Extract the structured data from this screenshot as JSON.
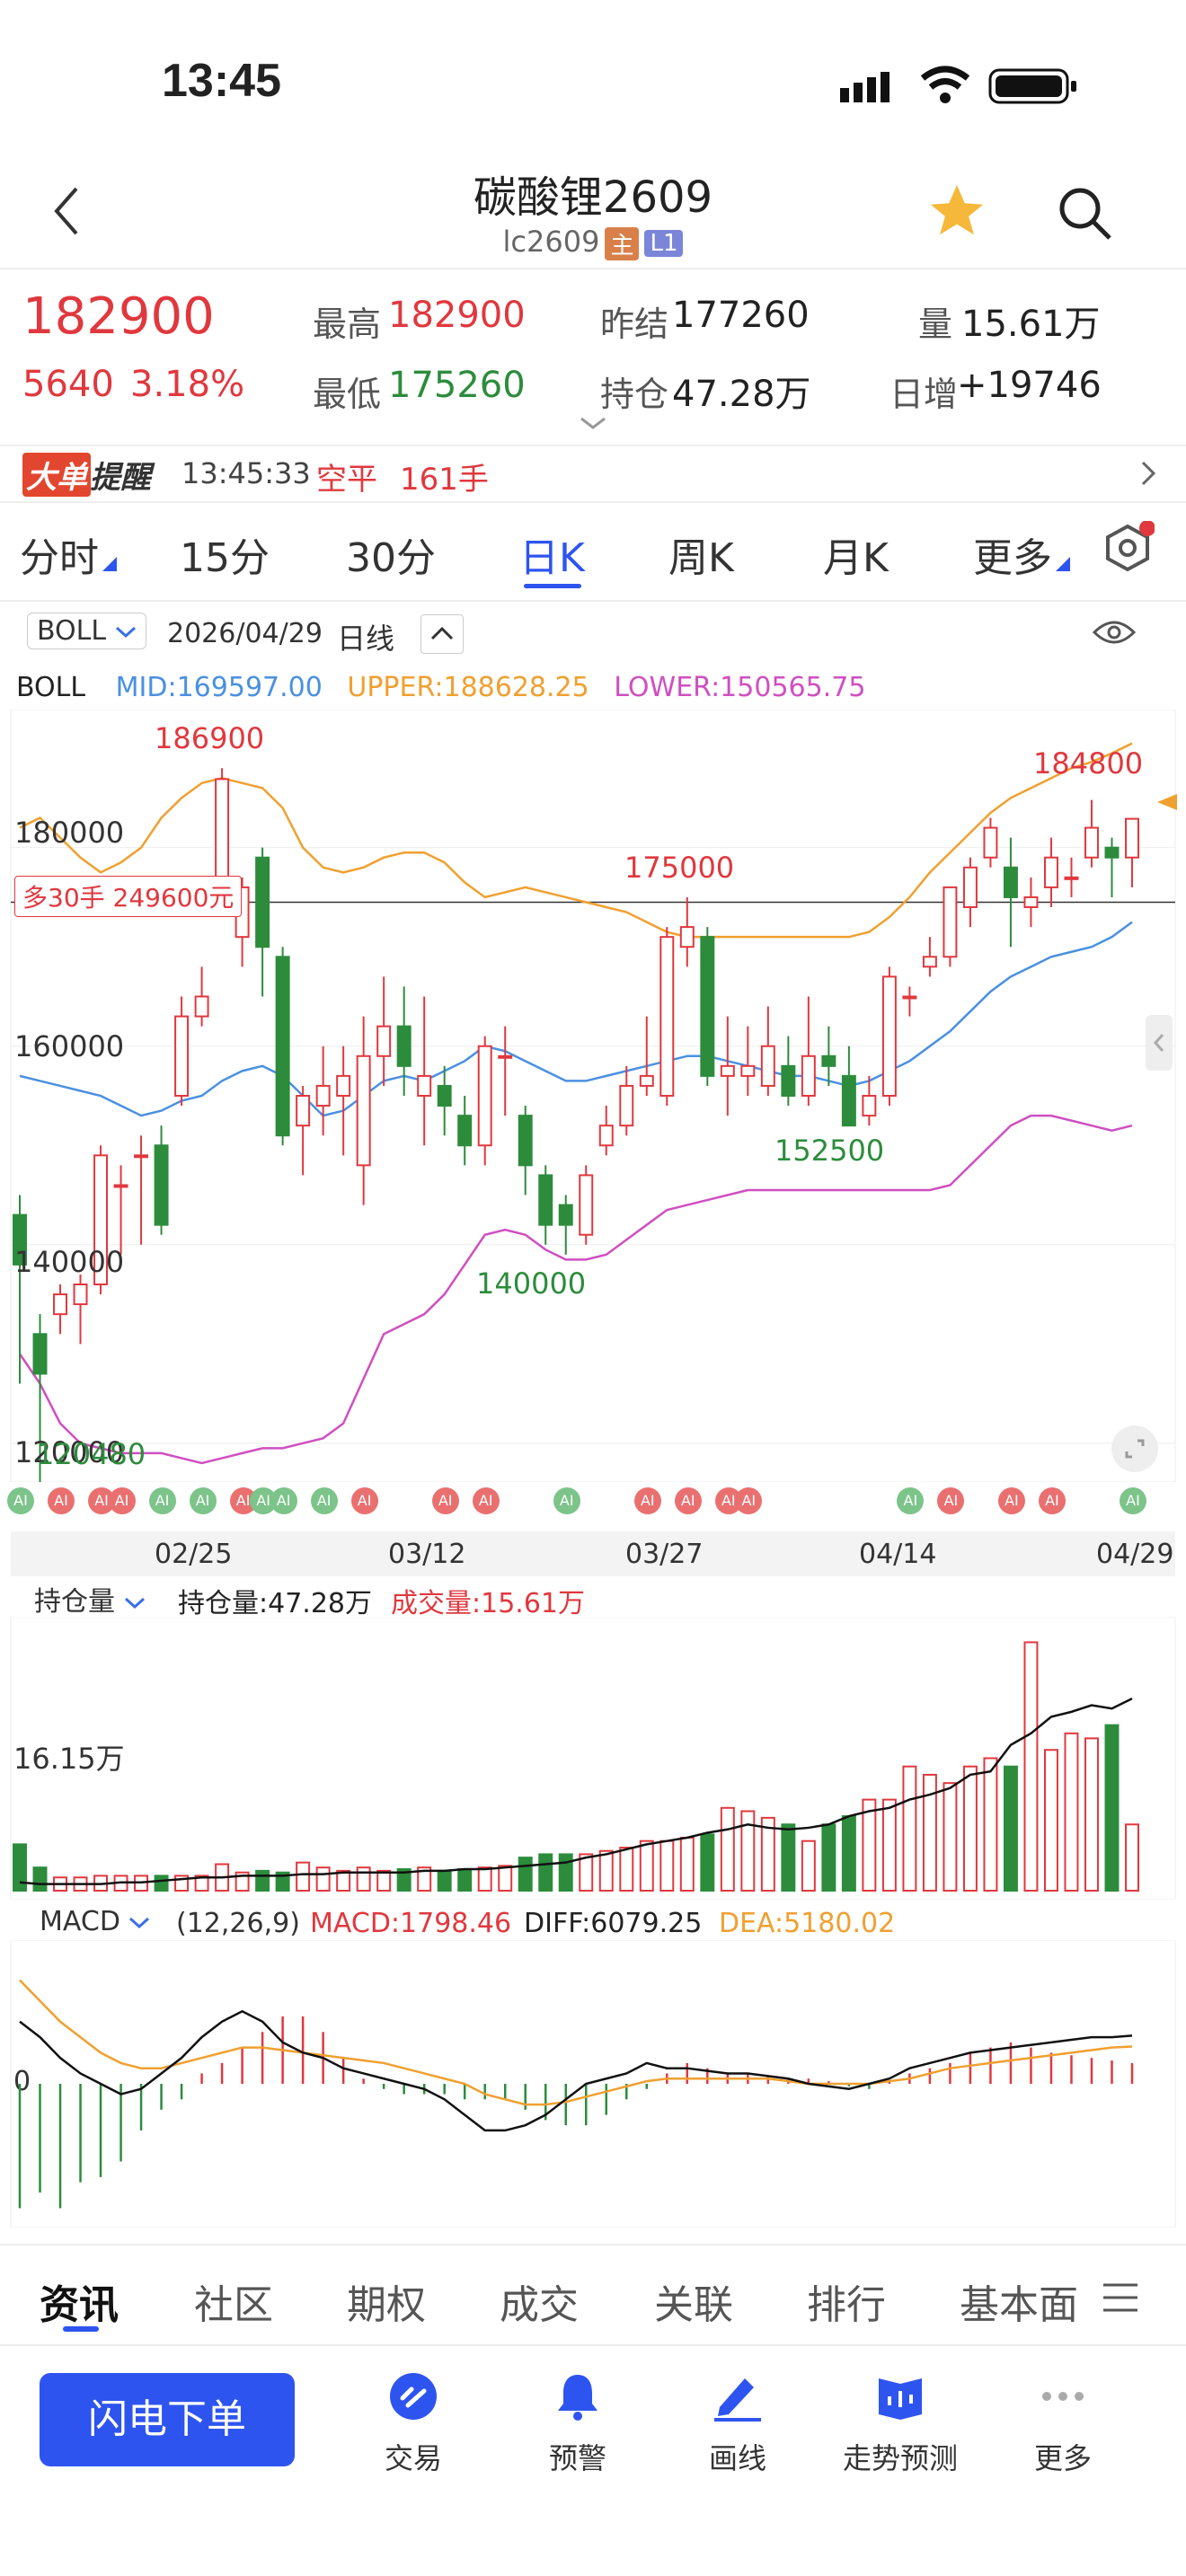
{
  "status": {
    "time": "13:45"
  },
  "header": {
    "title": "碳酸锂2609",
    "code": "lc2609",
    "tag_main": "主",
    "tag_level": "L1"
  },
  "quote": {
    "price": "182900",
    "change": "5640",
    "change_pct": "3.18%",
    "high_label": "最高",
    "high": "182900",
    "low_label": "最低",
    "low": "175260",
    "prev_label": "昨结",
    "prev": "177260",
    "oi_label": "持仓",
    "oi": "47.28万",
    "vol_label": "量",
    "vol": "15.61万",
    "daily_inc_label": "日增",
    "daily_inc": "+19746"
  },
  "alert": {
    "badge": "大单",
    "title": "提醒",
    "time": "13:45:33",
    "type": "空平",
    "qty": "161手"
  },
  "tabs": [
    "分时",
    "15分",
    "30分",
    "日K",
    "周K",
    "月K",
    "更多"
  ],
  "active_tab": "日K",
  "chart_header": {
    "indicator": "BOLL",
    "date": "2026/04/29",
    "period": "日线"
  },
  "boll": {
    "name": "BOLL",
    "mid": "MID:169597.00",
    "upper": "UPPER:188628.25",
    "lower": "LOWER:150565.75"
  },
  "price_axis": {
    "labels": [
      "180000",
      "160000",
      "140000",
      "120000"
    ],
    "marker": "多30手 249600元"
  },
  "annotations": {
    "high1": "186900",
    "high2": "175000",
    "high3": "184800",
    "low1": "140000",
    "low2": "152500",
    "low3": "120480"
  },
  "dates": [
    "02/25",
    "03/12",
    "03/27",
    "04/14",
    "04/29"
  ],
  "vol_header": {
    "selector": "持仓量",
    "oi": "持仓量:47.28万",
    "vol": "成交量:15.61万",
    "axis": "16.15万"
  },
  "macd_header": {
    "selector": "MACD",
    "params": "(12,26,9)",
    "macd": "MACD:1798.46",
    "diff": "DIFF:6079.25",
    "dea": "DEA:5180.02",
    "axis": "0"
  },
  "bottom_tabs": [
    "资讯",
    "社区",
    "期权",
    "成交",
    "关联",
    "排行",
    "基本面"
  ],
  "action_button": "闪电下单",
  "nav": [
    {
      "label": "交易",
      "icon": "trade-icon"
    },
    {
      "label": "预警",
      "icon": "bell-icon"
    },
    {
      "label": "画线",
      "icon": "draw-line-icon"
    },
    {
      "label": "走势预测",
      "icon": "trend-forecast-icon"
    },
    {
      "label": "更多",
      "icon": "more-dots-icon"
    }
  ],
  "colors": {
    "up": "#e0383e",
    "down": "#2c8c3c",
    "mid": "#4a90e2",
    "upper": "#f0a030",
    "lower": "#d04fc0",
    "accent": "#2e54f0"
  },
  "chart_data": {
    "type": "candlestick",
    "ylim": [
      117000,
      193000
    ],
    "candles": [
      [
        143000,
        138000,
        145000,
        126000
      ],
      [
        131000,
        127000,
        133000,
        115000
      ],
      [
        133000,
        135000,
        136000,
        131000
      ],
      [
        134000,
        136000,
        137000,
        130000
      ],
      [
        136000,
        149000,
        150000,
        135000
      ],
      [
        146000,
        146000,
        148000,
        139000
      ],
      [
        149000,
        149000,
        151000,
        140000
      ],
      [
        150000,
        142000,
        152000,
        141000
      ],
      [
        155000,
        163000,
        165000,
        154000
      ],
      [
        163000,
        165000,
        168000,
        162000
      ],
      [
        174000,
        186900,
        188000,
        173000
      ],
      [
        171000,
        176000,
        177000,
        168000
      ],
      [
        179000,
        170000,
        180000,
        165000
      ],
      [
        169000,
        151000,
        170000,
        150000
      ],
      [
        152000,
        155000,
        156000,
        147000
      ],
      [
        154000,
        156000,
        160000,
        151000
      ],
      [
        155000,
        157000,
        160000,
        149000
      ],
      [
        148000,
        159000,
        163000,
        144000
      ],
      [
        159000,
        162000,
        167000,
        156000
      ],
      [
        162000,
        158000,
        166000,
        155000
      ],
      [
        155000,
        157000,
        165000,
        150000
      ],
      [
        156000,
        154000,
        158000,
        151000
      ],
      [
        153000,
        150000,
        155000,
        148000
      ],
      [
        150000,
        160000,
        161000,
        148000
      ],
      [
        159000,
        159000,
        162000,
        153000
      ],
      [
        153000,
        148000,
        154000,
        145000
      ],
      [
        147000,
        142000,
        148000,
        140000
      ],
      [
        144000,
        142000,
        145000,
        139000
      ],
      [
        141000,
        147000,
        148000,
        140000
      ],
      [
        150000,
        152000,
        154000,
        149000
      ],
      [
        152000,
        156000,
        158000,
        151000
      ],
      [
        156000,
        157000,
        163000,
        155000
      ],
      [
        155000,
        171000,
        172000,
        154000
      ],
      [
        170000,
        172000,
        175000,
        168000
      ],
      [
        171000,
        157000,
        172000,
        156000
      ],
      [
        157000,
        158000,
        163000,
        153000
      ],
      [
        157000,
        158000,
        162000,
        155000
      ],
      [
        156000,
        160000,
        164000,
        155000
      ],
      [
        158000,
        155000,
        161000,
        154000
      ],
      [
        155000,
        159000,
        165000,
        154000
      ],
      [
        159000,
        158000,
        162000,
        156000
      ],
      [
        157000,
        152000,
        160000,
        152500
      ],
      [
        153000,
        155000,
        157000,
        152000
      ],
      [
        155000,
        167000,
        168000,
        154000
      ],
      [
        165000,
        165000,
        166000,
        163000
      ],
      [
        168000,
        169000,
        171000,
        167000
      ],
      [
        169000,
        176000,
        176000,
        168000
      ],
      [
        174000,
        178000,
        179000,
        172000
      ],
      [
        179000,
        182000,
        183000,
        178000
      ],
      [
        178000,
        175000,
        181000,
        170000
      ],
      [
        174000,
        175000,
        177000,
        172000
      ],
      [
        176000,
        179000,
        181000,
        174000
      ],
      [
        177000,
        177000,
        179000,
        175000
      ],
      [
        179000,
        182000,
        184800,
        178000
      ],
      [
        180000,
        179000,
        181000,
        175000
      ],
      [
        179000,
        182900,
        183000,
        176000
      ]
    ],
    "mid": [
      157000,
      156500,
      156000,
      155500,
      155000,
      154000,
      153000,
      153500,
      154500,
      155000,
      156500,
      157500,
      158000,
      157000,
      155000,
      153000,
      153500,
      155000,
      156500,
      157000,
      156500,
      157500,
      158500,
      160000,
      159500,
      158500,
      157500,
      156500,
      156500,
      157000,
      157500,
      158000,
      158500,
      159000,
      159000,
      158500,
      158000,
      157500,
      157000,
      157000,
      156500,
      156000,
      156500,
      157500,
      158500,
      160000,
      161500,
      163500,
      165500,
      167000,
      168000,
      169000,
      169500,
      170000,
      171000,
      172500
    ],
    "upper": [
      182000,
      183000,
      181000,
      179000,
      177500,
      178500,
      180000,
      183000,
      185000,
      186500,
      187000,
      186500,
      186000,
      184000,
      180000,
      178000,
      177500,
      178000,
      179000,
      179500,
      179500,
      178500,
      176500,
      175000,
      175500,
      176000,
      175500,
      175000,
      174500,
      174000,
      173500,
      172500,
      171500,
      171000,
      171000,
      171000,
      171000,
      171000,
      171000,
      171000,
      171000,
      171000,
      171500,
      173000,
      175000,
      177500,
      179500,
      181500,
      183500,
      185000,
      186000,
      187000,
      188000,
      188628,
      189500,
      190500
    ],
    "lower": [
      129000,
      126000,
      122000,
      120000,
      119500,
      119000,
      119000,
      119000,
      118500,
      118000,
      118500,
      119000,
      119500,
      119500,
      120000,
      120500,
      122000,
      126500,
      131000,
      132000,
      133000,
      135000,
      138000,
      141000,
      141500,
      141000,
      139500,
      138500,
      138500,
      139000,
      140500,
      142000,
      143500,
      144000,
      144500,
      145000,
      145500,
      145500,
      145500,
      145500,
      145500,
      145500,
      145500,
      145500,
      145500,
      145500,
      146000,
      148000,
      150000,
      152000,
      153000,
      153000,
      152500,
      152000,
      151500,
      152000
    ],
    "volume": [
      0.28,
      0.14,
      0.08,
      0.08,
      0.09,
      0.09,
      0.09,
      0.09,
      0.09,
      0.09,
      0.16,
      0.11,
      0.12,
      0.11,
      0.17,
      0.14,
      0.12,
      0.14,
      0.12,
      0.13,
      0.14,
      0.12,
      0.13,
      0.14,
      0.15,
      0.2,
      0.22,
      0.22,
      0.22,
      0.24,
      0.26,
      0.3,
      0.3,
      0.32,
      0.34,
      0.5,
      0.48,
      0.44,
      0.4,
      0.3,
      0.4,
      0.45,
      0.55,
      0.55,
      0.75,
      0.7,
      0.65,
      0.75,
      0.8,
      0.75,
      1.5,
      0.85,
      0.95,
      0.92,
      1.0,
      0.4
    ],
    "oi_line": [
      0.05,
      0.04,
      0.04,
      0.04,
      0.04,
      0.05,
      0.05,
      0.06,
      0.07,
      0.08,
      0.08,
      0.09,
      0.09,
      0.09,
      0.1,
      0.1,
      0.11,
      0.11,
      0.11,
      0.11,
      0.12,
      0.12,
      0.13,
      0.13,
      0.14,
      0.15,
      0.16,
      0.17,
      0.2,
      0.22,
      0.25,
      0.28,
      0.3,
      0.32,
      0.35,
      0.37,
      0.4,
      0.38,
      0.37,
      0.38,
      0.4,
      0.45,
      0.48,
      0.5,
      0.55,
      0.58,
      0.62,
      0.7,
      0.72,
      0.88,
      0.95,
      1.05,
      1.08,
      1.12,
      1.1,
      1.16
    ],
    "macd_hist": [
      -2.4,
      -2.1,
      -2.4,
      -1.9,
      -1.8,
      -1.5,
      -0.9,
      -0.5,
      -0.3,
      0.2,
      0.4,
      0.7,
      1.0,
      1.3,
      1.3,
      1.0,
      0.5,
      0.1,
      -0.1,
      -0.2,
      -0.2,
      -0.2,
      -0.3,
      -0.3,
      -0.3,
      -0.5,
      -0.7,
      -0.8,
      -0.8,
      -0.6,
      -0.3,
      -0.1,
      0.2,
      0.4,
      0.3,
      0.2,
      0.2,
      0.15,
      0.1,
      0.1,
      0.05,
      -0.05,
      -0.1,
      0.05,
      0.2,
      0.3,
      0.4,
      0.6,
      0.7,
      0.8,
      0.7,
      0.6,
      0.55,
      0.5,
      0.45,
      0.4
    ],
    "diff": [
      1.2,
      0.9,
      0.5,
      0.2,
      0.0,
      -0.2,
      -0.1,
      0.2,
      0.5,
      0.9,
      1.2,
      1.4,
      1.2,
      0.8,
      0.6,
      0.5,
      0.3,
      0.2,
      0.1,
      0.0,
      -0.1,
      -0.3,
      -0.6,
      -0.9,
      -0.9,
      -0.8,
      -0.6,
      -0.3,
      0.0,
      0.1,
      0.2,
      0.4,
      0.3,
      0.3,
      0.25,
      0.2,
      0.2,
      0.15,
      0.1,
      0.0,
      -0.05,
      -0.1,
      0.0,
      0.1,
      0.3,
      0.4,
      0.5,
      0.6,
      0.65,
      0.7,
      0.75,
      0.8,
      0.85,
      0.9,
      0.9,
      0.93
    ],
    "dea": [
      2.0,
      1.6,
      1.2,
      0.9,
      0.6,
      0.4,
      0.3,
      0.3,
      0.4,
      0.5,
      0.6,
      0.7,
      0.7,
      0.65,
      0.6,
      0.55,
      0.5,
      0.45,
      0.4,
      0.3,
      0.2,
      0.1,
      0.0,
      -0.2,
      -0.3,
      -0.4,
      -0.4,
      -0.35,
      -0.25,
      -0.15,
      -0.05,
      0.05,
      0.1,
      0.1,
      0.1,
      0.1,
      0.1,
      0.1,
      0.05,
      0.0,
      0.0,
      0.0,
      0.0,
      0.05,
      0.1,
      0.2,
      0.3,
      0.35,
      0.4,
      0.45,
      0.5,
      0.55,
      0.6,
      0.65,
      0.7,
      0.72
    ]
  }
}
